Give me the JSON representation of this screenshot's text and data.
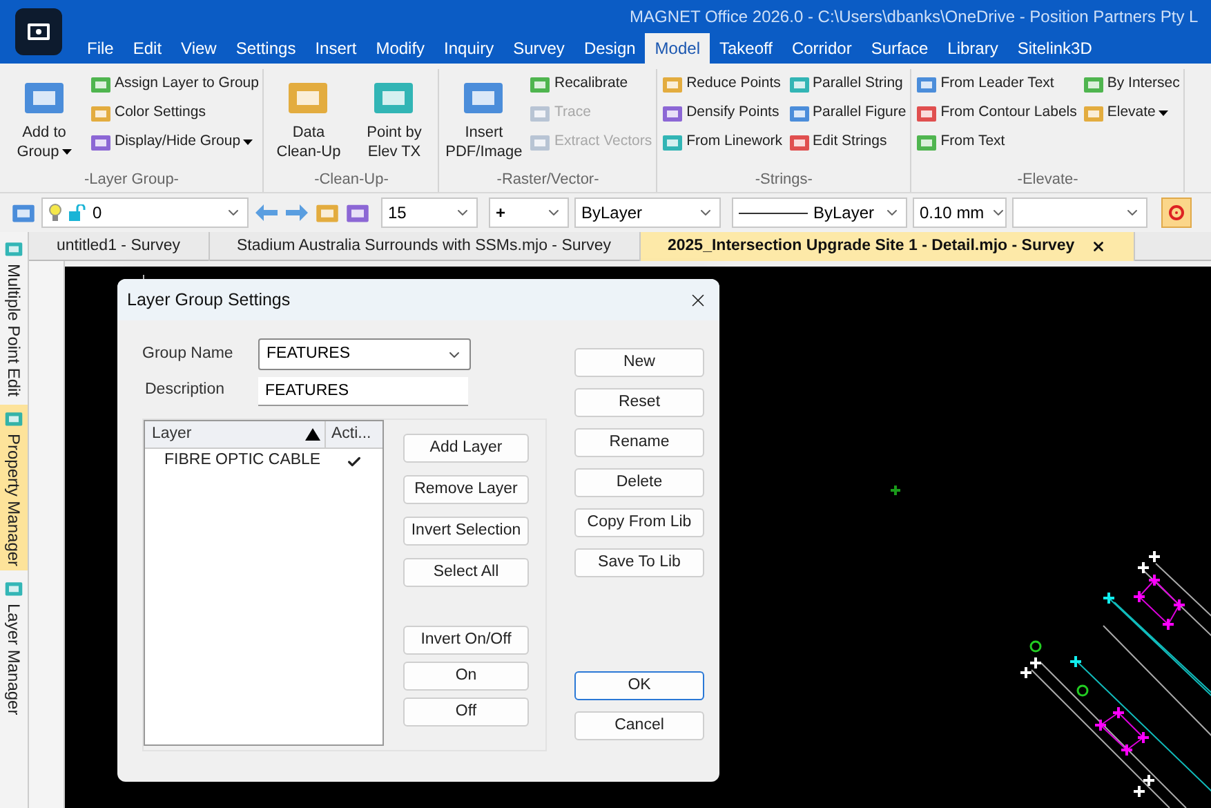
{
  "window": {
    "title": "MAGNET Office 2026.0 - C:\\Users\\dbanks\\OneDrive - Position Partners Pty L"
  },
  "menu": [
    {
      "label": "File",
      "selected": false
    },
    {
      "label": "Edit",
      "selected": false
    },
    {
      "label": "View",
      "selected": false
    },
    {
      "label": "Settings",
      "selected": false
    },
    {
      "label": "Insert",
      "selected": false
    },
    {
      "label": "Modify",
      "selected": false
    },
    {
      "label": "Inquiry",
      "selected": false
    },
    {
      "label": "Survey",
      "selected": false
    },
    {
      "label": "Design",
      "selected": false
    },
    {
      "label": "Model",
      "selected": true
    },
    {
      "label": "Takeoff",
      "selected": false
    },
    {
      "label": "Corridor",
      "selected": false
    },
    {
      "label": "Surface",
      "selected": false
    },
    {
      "label": "Library",
      "selected": false
    },
    {
      "label": "Sitelink3D",
      "selected": false
    }
  ],
  "ribbon": [
    {
      "label": "-Layer Group-",
      "columns": [
        [
          {
            "kind": "large",
            "label": "Add to Group",
            "dropdown": true,
            "disabled": false
          }
        ],
        [
          {
            "kind": "small",
            "label": "Assign Layer to Group",
            "dropdown": false,
            "disabled": false
          },
          {
            "kind": "small",
            "label": "Color Settings",
            "dropdown": false,
            "disabled": false
          },
          {
            "kind": "small",
            "label": "Display/Hide Group",
            "dropdown": true,
            "disabled": false
          }
        ]
      ]
    },
    {
      "label": "-Clean-Up-",
      "columns": [
        [
          {
            "kind": "large",
            "label": "Data Clean-Up",
            "dropdown": false,
            "disabled": false
          }
        ],
        [
          {
            "kind": "large",
            "label": "Point by Elev TX",
            "dropdown": false,
            "disabled": false
          }
        ]
      ]
    },
    {
      "label": "-Raster/Vector-",
      "columns": [
        [
          {
            "kind": "large",
            "label": "Insert PDF/Image",
            "dropdown": false,
            "disabled": false
          }
        ],
        [
          {
            "kind": "small",
            "label": "Recalibrate",
            "dropdown": false,
            "disabled": false
          },
          {
            "kind": "small",
            "label": "Trace",
            "dropdown": false,
            "disabled": true
          },
          {
            "kind": "small",
            "label": "Extract Vectors",
            "dropdown": false,
            "disabled": true
          }
        ]
      ]
    },
    {
      "label": "-Strings-",
      "columns": [
        [
          {
            "kind": "small",
            "label": "Reduce Points",
            "dropdown": false,
            "disabled": false
          },
          {
            "kind": "small",
            "label": "Densify Points",
            "dropdown": false,
            "disabled": false
          },
          {
            "kind": "small",
            "label": "From Linework",
            "dropdown": false,
            "disabled": false
          }
        ],
        [
          {
            "kind": "small",
            "label": "Parallel String",
            "dropdown": false,
            "disabled": false
          },
          {
            "kind": "small",
            "label": "Parallel Figure",
            "dropdown": false,
            "disabled": false
          },
          {
            "kind": "small",
            "label": "Edit Strings",
            "dropdown": false,
            "disabled": false
          }
        ]
      ]
    },
    {
      "label": "-Elevate-",
      "columns": [
        [
          {
            "kind": "small",
            "label": "From Leader Text",
            "dropdown": false,
            "disabled": false
          },
          {
            "kind": "small",
            "label": "From Contour Labels",
            "dropdown": false,
            "disabled": false
          },
          {
            "kind": "small",
            "label": "From Text",
            "dropdown": false,
            "disabled": false
          }
        ],
        [
          {
            "kind": "small",
            "label": "By Intersec",
            "dropdown": false,
            "disabled": false
          },
          {
            "kind": "small",
            "label": "Elevate",
            "dropdown": true,
            "disabled": false
          }
        ]
      ]
    }
  ],
  "toolbar": {
    "layer": "0",
    "text_size": "15",
    "point_style": "+",
    "color_by": "ByLayer",
    "linetype": "ByLayer",
    "lineweight": "0.10 mm"
  },
  "documents": [
    {
      "label": "untitled1 - Survey",
      "selected": false
    },
    {
      "label": "Stadium Australia Surrounds with SSMs.mjo - Survey",
      "selected": false
    },
    {
      "label": "2025_Intersection Upgrade Site 1 - Detail.mjo - Survey",
      "selected": true
    }
  ],
  "side_panels": [
    {
      "label": "Multiple Point Edit",
      "selected": false
    },
    {
      "label": "Property Manager",
      "selected": true
    },
    {
      "label": "Layer Manager",
      "selected": false
    }
  ],
  "dialog": {
    "title": "Layer Group Settings",
    "group_name": {
      "label": "Group Name",
      "value": "FEATURES"
    },
    "description": {
      "label": "Description",
      "value": "FEATURES"
    },
    "layer_list": {
      "columns": [
        "Layer",
        "Acti..."
      ],
      "rows": [
        {
          "layer": "FIBRE OPTIC CABLE",
          "active": true
        }
      ]
    },
    "list_buttons": [
      {
        "label": "Add Layer"
      },
      {
        "label": "Remove Layer"
      },
      {
        "label": "Invert Selection"
      },
      {
        "label": "Select All"
      },
      {
        "label": "Invert On/Off"
      },
      {
        "label": "On"
      },
      {
        "label": "Off"
      }
    ],
    "group_buttons": [
      {
        "label": "New"
      },
      {
        "label": "Reset"
      },
      {
        "label": "Rename"
      },
      {
        "label": "Delete"
      },
      {
        "label": "Copy From Lib"
      },
      {
        "label": "Save To Lib"
      }
    ],
    "action_buttons": [
      {
        "label": "OK",
        "default": true
      },
      {
        "label": "Cancel",
        "default": false
      }
    ]
  }
}
